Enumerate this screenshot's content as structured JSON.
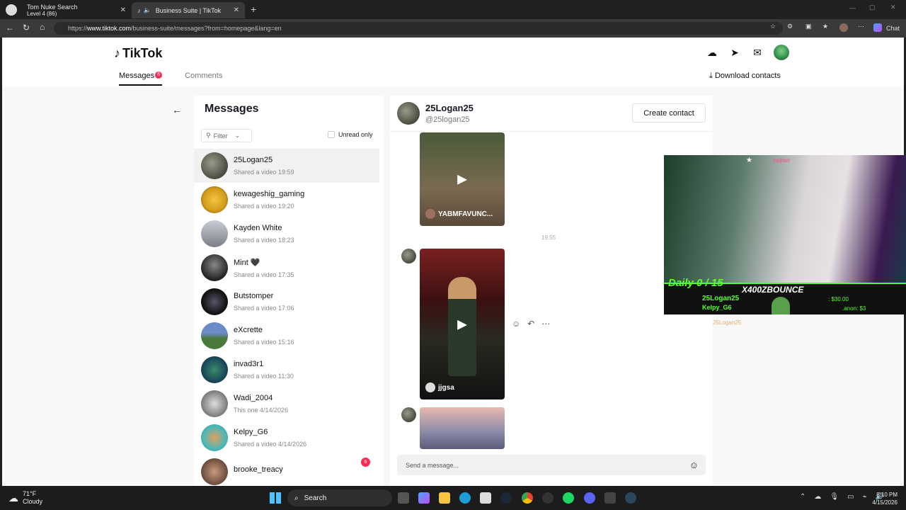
{
  "browser": {
    "tabs": [
      {
        "title": "Tom Nuke Search",
        "subtitle": "Level 4 (86)"
      },
      {
        "title": "Business Suite | TikTok"
      }
    ],
    "new_tab_icon": "plus-icon",
    "url_prefix": "https://",
    "url_host": "www.tiktok.com",
    "url_path": "/business-suite/messages?from=homepage&lang=en",
    "chat_label": "Chat"
  },
  "header": {
    "logo": "TikTok",
    "tabs": {
      "messages": "Messages",
      "messages_badge": "6",
      "comments": "Comments"
    },
    "download": "Download contacts"
  },
  "sidebar": {
    "title": "Messages",
    "filter": "Filter",
    "unread_only": "Unread only",
    "conversations": [
      {
        "name": "25Logan25",
        "sub": "Shared a video 19:59"
      },
      {
        "name": "kewageshig_gaming",
        "sub": "Shared a video 19:20"
      },
      {
        "name": "Kayden White",
        "sub": "Shared a video 18:23"
      },
      {
        "name": "Mint 🖤",
        "sub": "Shared a video 17:35"
      },
      {
        "name": "Butstomper",
        "sub": "Shared a video 17:06"
      },
      {
        "name": "eXcrette",
        "sub": "Shared a video 15:16"
      },
      {
        "name": "invad3r1",
        "sub": "Shared a video 11:30"
      },
      {
        "name": "Wadi_2004",
        "sub": "This one 4/14/2026"
      },
      {
        "name": "Kelpy_G6",
        "sub": "Shared a video 4/14/2026"
      },
      {
        "name": "brooke_treacy",
        "sub": "",
        "badge": "6"
      }
    ]
  },
  "chat": {
    "name": "25Logan25",
    "handle": "@25logan25",
    "create_contact": "Create contact",
    "video1_caption": "YABMFAVUNC...",
    "timestamp": "19:55",
    "video2_caption": "jjgsa",
    "placeholder": "Send a message..."
  },
  "overlay": {
    "daily": "Daily 0 / 15",
    "name": "X400ZBOUNCE",
    "line1": "25Logan25",
    "line2": "Kelpy_G6",
    "amount1": ": $30.00",
    "amount2": ".anon: $3",
    "top_name": "zalparr",
    "chat_user": "25Logan25:"
  },
  "taskbar": {
    "weather_temp": "71°F",
    "weather_desc": "Cloudy",
    "search": "Search",
    "time": "8:10 PM",
    "date": "4/15/2026"
  }
}
